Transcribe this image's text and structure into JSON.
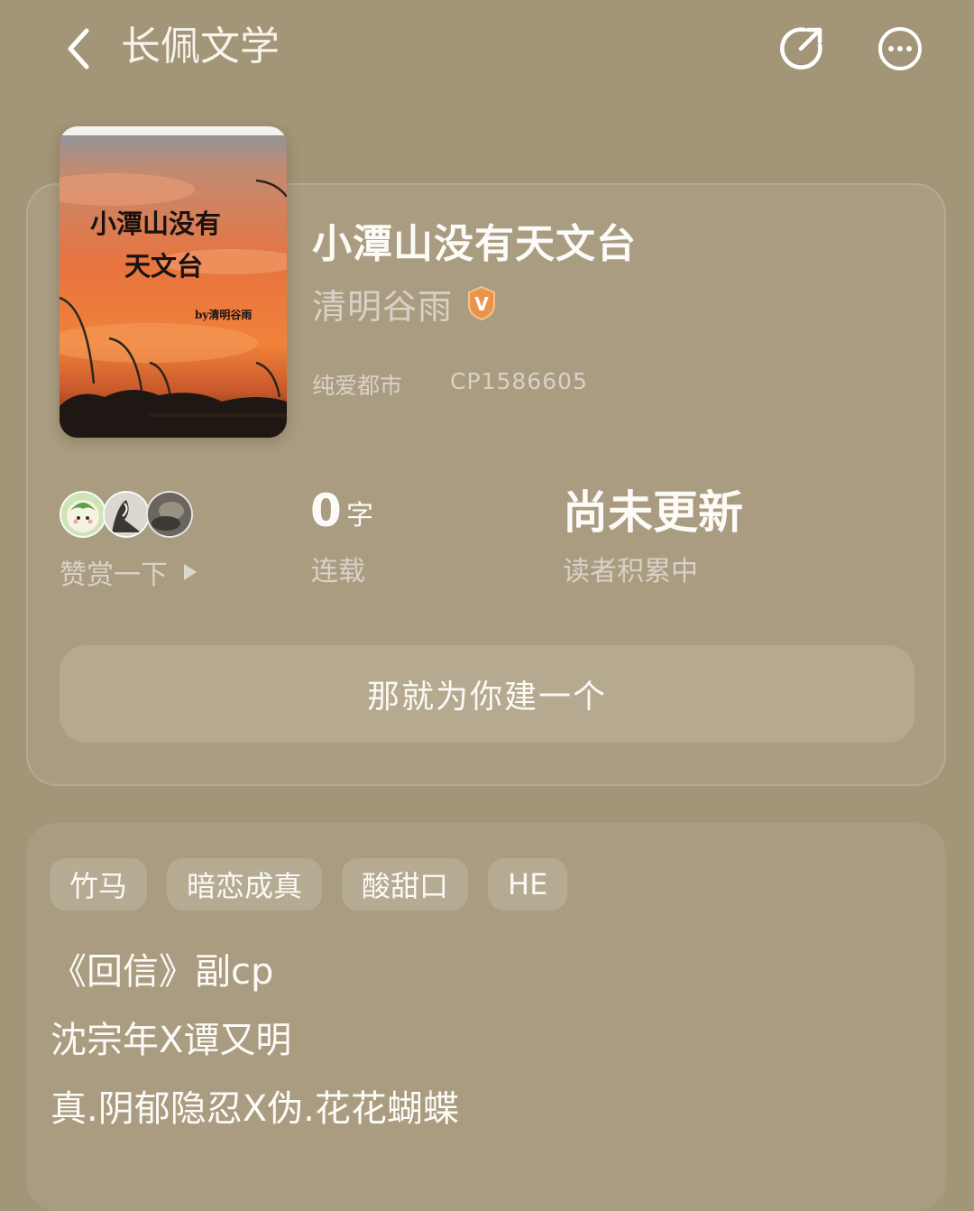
{
  "header": {
    "title": "长佩文学",
    "back_icon": "chevron-left-icon",
    "share_icon": "share-icon",
    "more_icon": "more-dots-icon"
  },
  "book": {
    "cover": {
      "title_line1": "小潭山没有",
      "title_line2": "天文台",
      "byline": "by清明谷雨"
    },
    "title": "小潭山没有天文台",
    "author": "清明谷雨",
    "verified_badge": "V",
    "genre": "纯爱都市",
    "cp_id": "CP1586605"
  },
  "stats": {
    "reward_label": "赞赏一下",
    "word_count": "0",
    "word_unit": "字",
    "word_label": "连载",
    "update_status": "尚未更新",
    "update_label": "读者积累中"
  },
  "action": {
    "build_button": "那就为你建一个"
  },
  "tags": [
    "竹马",
    "暗恋成真",
    "酸甜口",
    "HE"
  ],
  "description": [
    "《回信》副cp",
    "沈宗年X谭又明",
    "真.阴郁隐忍X伪.花花蝴蝶"
  ],
  "colors": {
    "background": "#a39577",
    "badge": "#e8954a"
  }
}
